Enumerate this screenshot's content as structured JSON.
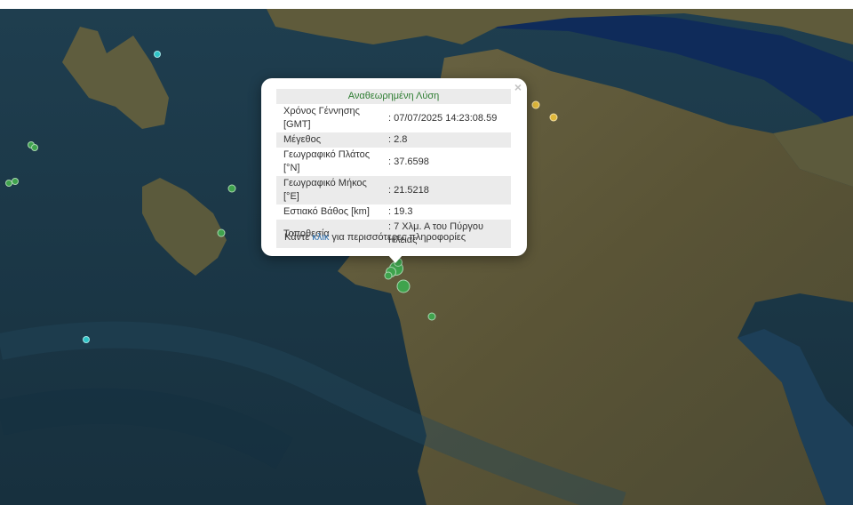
{
  "popup": {
    "title": "Αναθεωρημένη Λύση",
    "close_symbol": "×",
    "rows": [
      {
        "label": "Χρόνος Γέννησης [GMT]",
        "value": ": 07/07/2025 14:23:08.59"
      },
      {
        "label": "Μέγεθος",
        "value": ": 2.8"
      },
      {
        "label": "Γεωγραφικό Πλάτος [°N]",
        "value": ": 37.6598"
      },
      {
        "label": "Γεωγραφικό Μήκος [°E]",
        "value": ": 21.5218"
      },
      {
        "label": "Εστιακό Βάθος [km]",
        "value": ": 19.3"
      },
      {
        "label": "Τοποθεσία",
        "value": ": 7 Χλμ. Α του Πύργου Ηλείας"
      }
    ],
    "more_prefix": "Κάντε",
    "more_link": "κλικ",
    "more_suffix": "για περισσότερες πληροφορίες"
  },
  "colors": {
    "sea": "#1b3a4b",
    "land": "#5e5a3a",
    "title_green": "#2e7d32",
    "link_blue": "#2a6fb0",
    "quake_green": "#3fa34d",
    "quake_cyan": "#2ec4c7",
    "quake_yellow": "#e0b83a"
  }
}
